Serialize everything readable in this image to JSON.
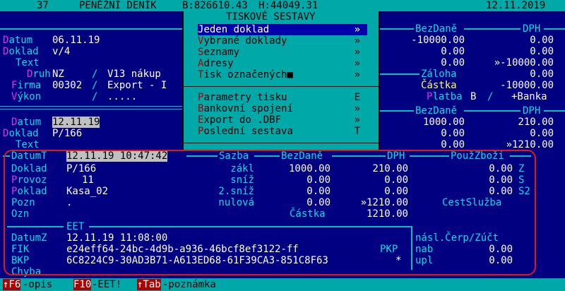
{
  "topbar": {
    "number": "37",
    "title": "PENĚŽNÍ DENÍK",
    "b_balance": "B:826610.43",
    "h_balance": "H:44049.31",
    "date": "12.11.2019"
  },
  "menu": {
    "title": "TISKOVÉ SESTAVY",
    "items": [
      {
        "hot": "J",
        "rest": "eden doklad",
        "right": "»"
      },
      {
        "hot": "V",
        "rest": "ybrané doklady",
        "right": "»"
      },
      {
        "hot": "S",
        "rest": "eznamy",
        "right": "»"
      },
      {
        "hot": "A",
        "rest": "dresy",
        "right": "»"
      },
      {
        "hot": "T",
        "rest": "isk označených■",
        "right": "»"
      },
      {
        "hot": "P",
        "rest": "arametry tisku",
        "right": "E"
      },
      {
        "hot": "B",
        "rest": "ankovní spojení",
        "right": "»"
      },
      {
        "hot": "E",
        "rest": "xport do .DBF",
        "right": "»"
      },
      {
        "hot": "P",
        "rest": "oslední sestava",
        "right": "T"
      }
    ]
  },
  "doc1": {
    "datum_label": "Datum",
    "datum": "06.11.19",
    "doklad_label": "Doklad",
    "doklad": "v/4",
    "text_label": "Text",
    "druh_label": "Druh",
    "druh": "NZ",
    "druh_desc": "V13 nákup",
    "firma_label": "Firma",
    "firma": "00302",
    "firma_desc": "Export - I",
    "vykon_label": "Výkon",
    "vykon": ".....",
    "bezdane_header": "BezDaně",
    "dph_header": "DPH",
    "row1_bez": "-10000.00",
    "row1_dph": "0.00",
    "row2_bez": "0.00",
    "row2_dph": "0.00",
    "row3_bez": "0.00",
    "row3_dph": "»-10000.00",
    "zaloha_label": "Záloha",
    "zaloha": "0.00",
    "castka_label": "Částka",
    "castka": "-10000.00",
    "platba_label": "Platba",
    "platba_code": "B",
    "platba": "+Banka"
  },
  "doc2": {
    "datum_label": "Datum",
    "datum": "12.11.19",
    "doklad_label": "Doklad",
    "doklad": "P/166",
    "text_label": "Text",
    "bezdane_header": "BezDaně",
    "dph_header": "DPH",
    "row1_bez": "1000.00",
    "row1_dph": "210.00",
    "row2_bez": "0.00",
    "row2_dph": "0.00",
    "row3_bez": "0.00",
    "row3_dph": "»1210.00"
  },
  "eet_panel": {
    "datumt_label": "DatumT",
    "datumt": "12.11.19 10:47:42",
    "sazba_header": "Sazba",
    "bezdane_header": "BezDaně",
    "dph_header": "DPH",
    "pouz_header": "PoužZboží",
    "doklad_label": "Doklad",
    "doklad": "P/166",
    "provoz_label": "Provoz",
    "provoz": "11",
    "pokladna_label": "Pokladna",
    "pokladna": "Kasa_02",
    "pozn_label": "Pozn",
    "pozn": ".",
    "ozn_label": "Ozn",
    "rows": [
      {
        "sazba": "zákl",
        "bez": "1000.00",
        "dph": "210.00",
        "pouz": "0.00",
        "code": "Z"
      },
      {
        "sazba": "sníž",
        "bez": "0.00",
        "dph": "0.00",
        "pouz": "0.00",
        "code": "S"
      },
      {
        "sazba": "2.sníž",
        "bez": "0.00",
        "dph": "0.00",
        "pouz": "0.00",
        "code": "S2"
      },
      {
        "sazba": "nulová",
        "bez": "0.00",
        "dph": "»1210.00",
        "pouz": "CestSlužba",
        "code": ""
      }
    ],
    "castka_label": "Částka",
    "castka": "1210.00",
    "eet_title": "EET",
    "datumz_label": "DatumZ",
    "datumz": "12.11.19 11:08:00",
    "fik_label": "FIK",
    "fik": "e24eff64-24bc-4d9b-a936-46bcf8ef3122-ff",
    "pkp_label": "PKP",
    "bkp_label": "BKP",
    "bkp": "6C8224C9-30AD3B71-A613ED68-61F39CA3-851C8F63",
    "bkp_mark": "*",
    "chyba_label": "Chyba",
    "nasl_label": "násl.Čerp/Zúčt",
    "nab_label": "nab",
    "nab": "0.00",
    "upl_label": "upl",
    "upl": "0.00"
  },
  "bottombar": {
    "k1": "↑F6",
    "l1": "-opis",
    "k2": "F10",
    "l2": "-EET!",
    "k3": "↑Tab",
    "l3": "-poznámka"
  }
}
